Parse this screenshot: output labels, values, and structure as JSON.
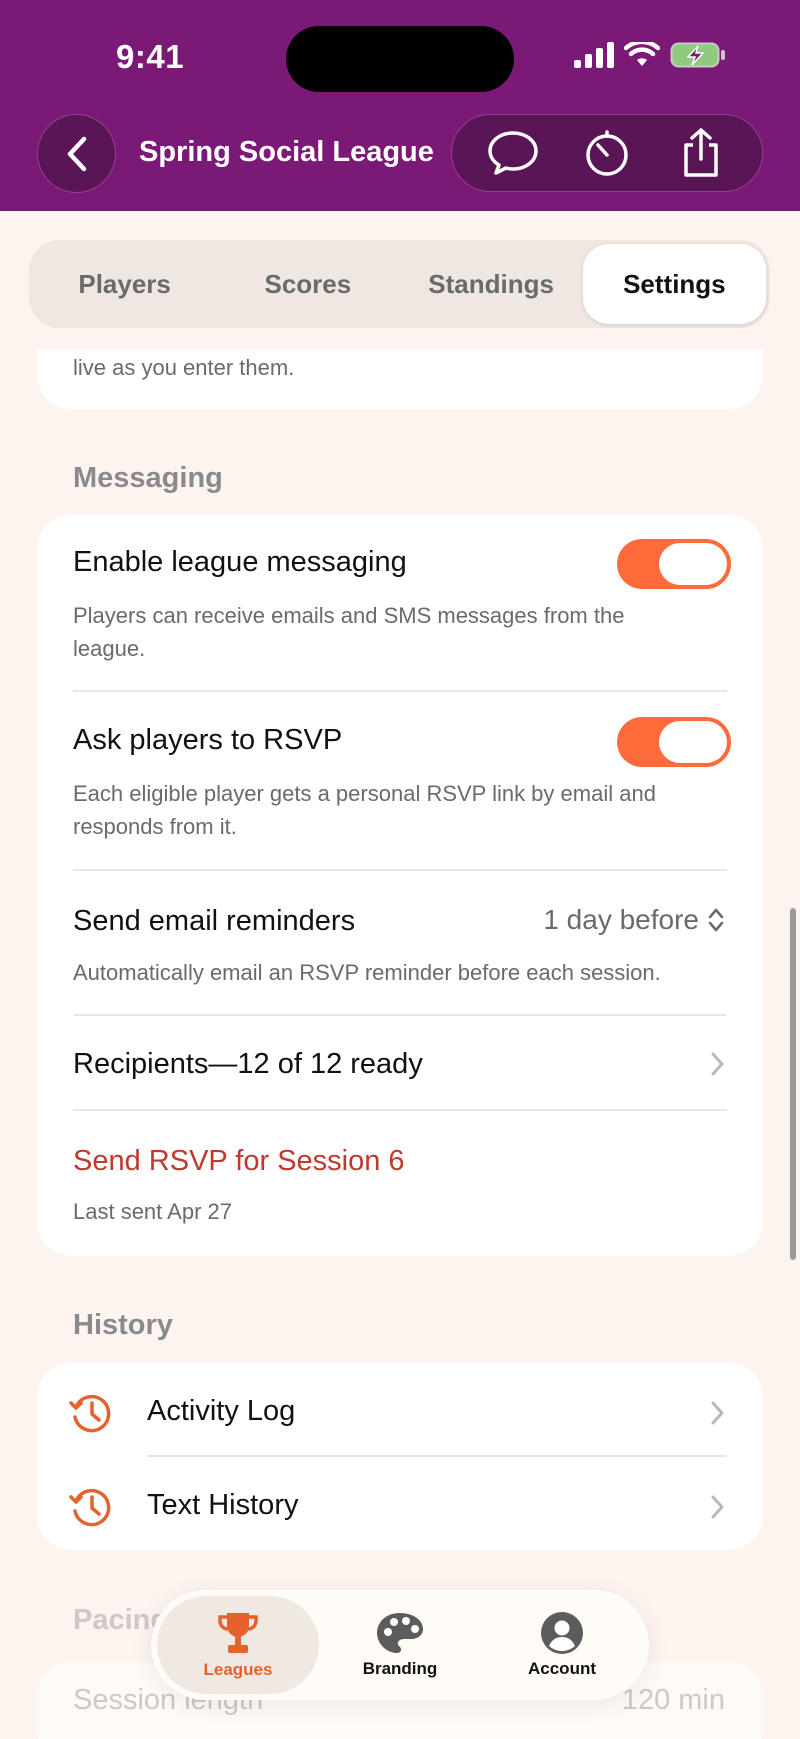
{
  "status_bar": {
    "time": "9:41"
  },
  "nav": {
    "title": "Spring Social League"
  },
  "segments": [
    {
      "label": "Players",
      "active": false
    },
    {
      "label": "Scores",
      "active": false
    },
    {
      "label": "Standings",
      "active": false
    },
    {
      "label": "Settings",
      "active": true
    }
  ],
  "top_card": {
    "text": "live as you enter them."
  },
  "messaging": {
    "label": "Messaging",
    "enable": {
      "title": "Enable league messaging",
      "subtitle": "Players can receive emails and SMS messages from the league.",
      "on": true
    },
    "rsvp": {
      "title": "Ask players to RSVP",
      "subtitle": "Each eligible player gets a personal RSVP link by email and responds from it.",
      "on": true
    },
    "reminders": {
      "title": "Send email reminders",
      "value": "1 day before",
      "subtitle": "Automatically email an RSVP reminder before each session."
    },
    "recipients": {
      "title": "Recipients—12 of 12 ready"
    },
    "send": {
      "title": "Send RSVP for Session 6",
      "subtitle": "Last sent Apr 27"
    }
  },
  "history": {
    "label": "History",
    "items": [
      {
        "title": "Activity Log"
      },
      {
        "title": "Text History"
      }
    ]
  },
  "pacing": {
    "label": "Pacing",
    "session_length": {
      "title": "Session length",
      "value": "120 min"
    }
  },
  "tabbar": [
    {
      "label": "Leagues",
      "icon": "trophy-icon",
      "active": true
    },
    {
      "label": "Branding",
      "icon": "palette-icon",
      "active": false
    },
    {
      "label": "Account",
      "icon": "account-icon",
      "active": false
    }
  ],
  "colors": {
    "header": "#7B1A76",
    "accent": "#FF6A3A",
    "destructive": "#C0392B",
    "background": "#FDF4EF"
  }
}
